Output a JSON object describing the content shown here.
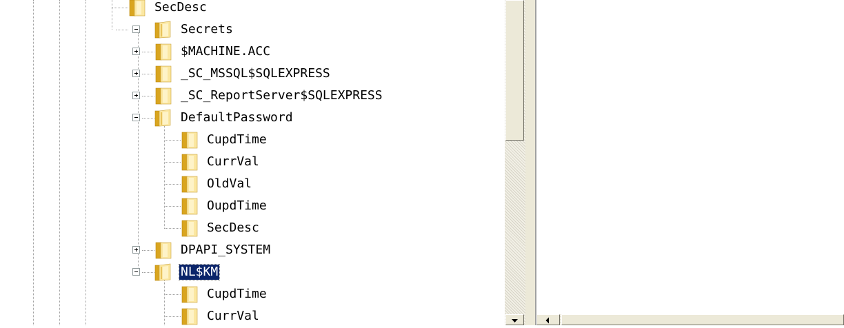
{
  "tree": {
    "items": [
      {
        "label": "SecDesc",
        "expander": "none",
        "icon": "folder-icon",
        "selected": false
      },
      {
        "label": "Secrets",
        "expander": "minus",
        "icon": "folder-open-icon",
        "selected": false
      },
      {
        "label": "$MACHINE.ACC",
        "expander": "plus",
        "icon": "folder-icon",
        "selected": false
      },
      {
        "label": "_SC_MSSQL$SQLEXPRESS",
        "expander": "plus",
        "icon": "folder-icon",
        "selected": false
      },
      {
        "label": "_SC_ReportServer$SQLEXPRESS",
        "expander": "plus",
        "icon": "folder-icon",
        "selected": false
      },
      {
        "label": "DefaultPassword",
        "expander": "minus",
        "icon": "folder-open-icon",
        "selected": false
      },
      {
        "label": "CupdTime",
        "expander": "none",
        "icon": "folder-icon",
        "selected": false
      },
      {
        "label": "CurrVal",
        "expander": "none",
        "icon": "folder-icon",
        "selected": false
      },
      {
        "label": "OldVal",
        "expander": "none",
        "icon": "folder-icon",
        "selected": false
      },
      {
        "label": "OupdTime",
        "expander": "none",
        "icon": "folder-icon",
        "selected": false
      },
      {
        "label": "SecDesc",
        "expander": "none",
        "icon": "folder-icon",
        "selected": false
      },
      {
        "label": "DPAPI_SYSTEM",
        "expander": "plus",
        "icon": "folder-icon",
        "selected": false
      },
      {
        "label": "NL$KM",
        "expander": "minus",
        "icon": "folder-open-icon",
        "selected": true
      },
      {
        "label": "CupdTime",
        "expander": "none",
        "icon": "folder-icon",
        "selected": false
      },
      {
        "label": "CurrVal",
        "expander": "none",
        "icon": "folder-icon",
        "selected": false
      }
    ]
  },
  "colors": {
    "selection": "#0a246a",
    "folder_light": "#fbe7a1",
    "folder_dark": "#d9a520",
    "scrollbar_face": "#ece9d8"
  }
}
